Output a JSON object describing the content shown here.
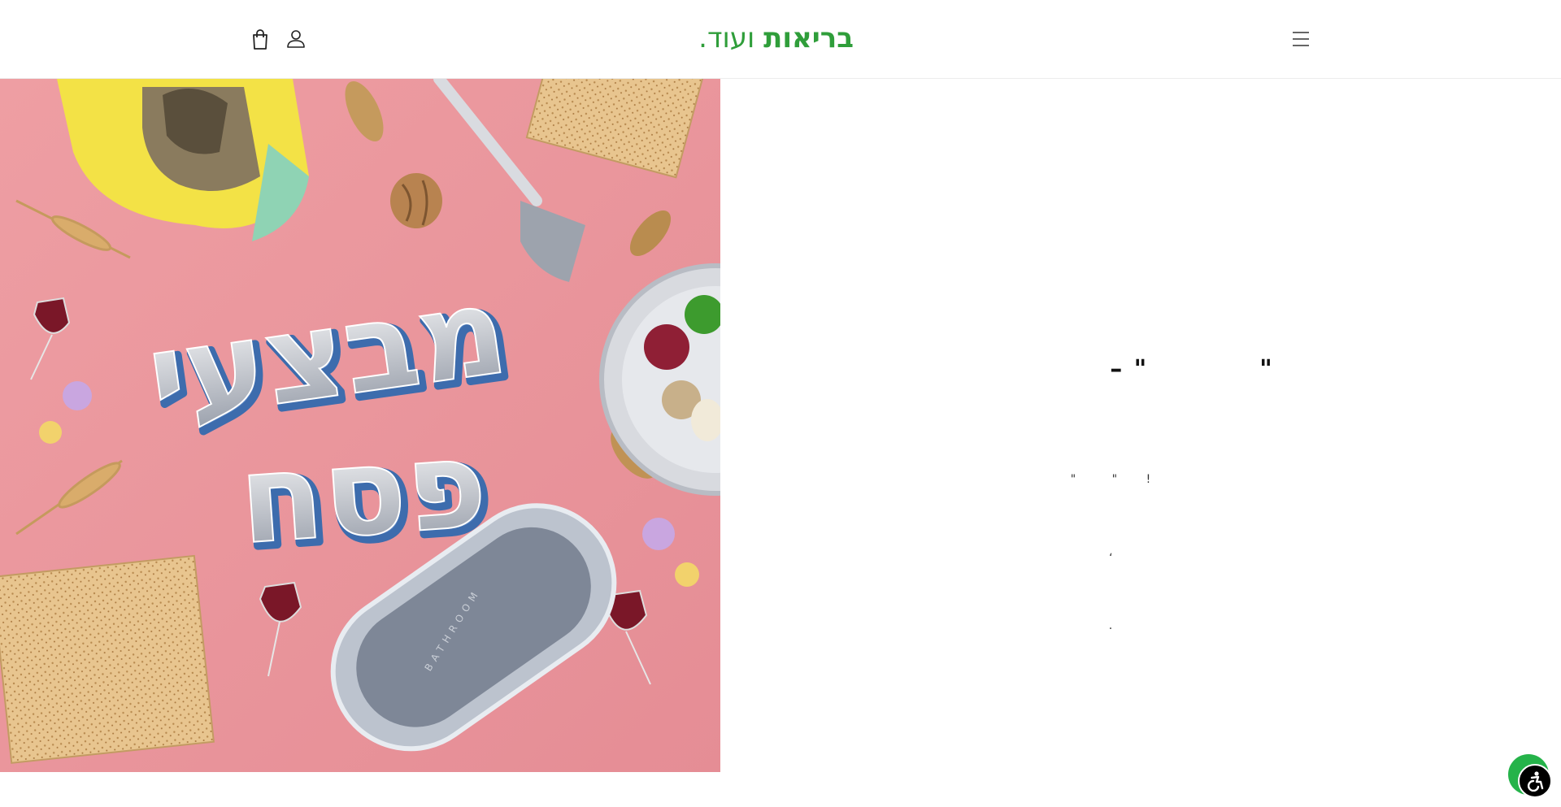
{
  "header": {
    "logo_bold": "בריאות",
    "logo_light": "ועוד",
    "logo_dot": ".",
    "cart_icon": "shopping-bag-icon",
    "account_icon": "user-icon",
    "menu_icon": "hamburger-menu-icon"
  },
  "hero": {
    "image_title_line1": "מבצעי",
    "image_title_line2": "פסח",
    "mat_text": "BATHROOM",
    "heading": "\"           \" –",
    "body_line1": "!        \"          \"",
    "body_line2": "،",
    "body_line3": "."
  },
  "widgets": {
    "whatsapp_icon": "whatsapp-icon",
    "accessibility_icon": "accessibility-icon"
  },
  "colors": {
    "brand_green": "#2f9e3a",
    "hero_background": "#e79aa0",
    "whatsapp_green": "#25b34a"
  }
}
